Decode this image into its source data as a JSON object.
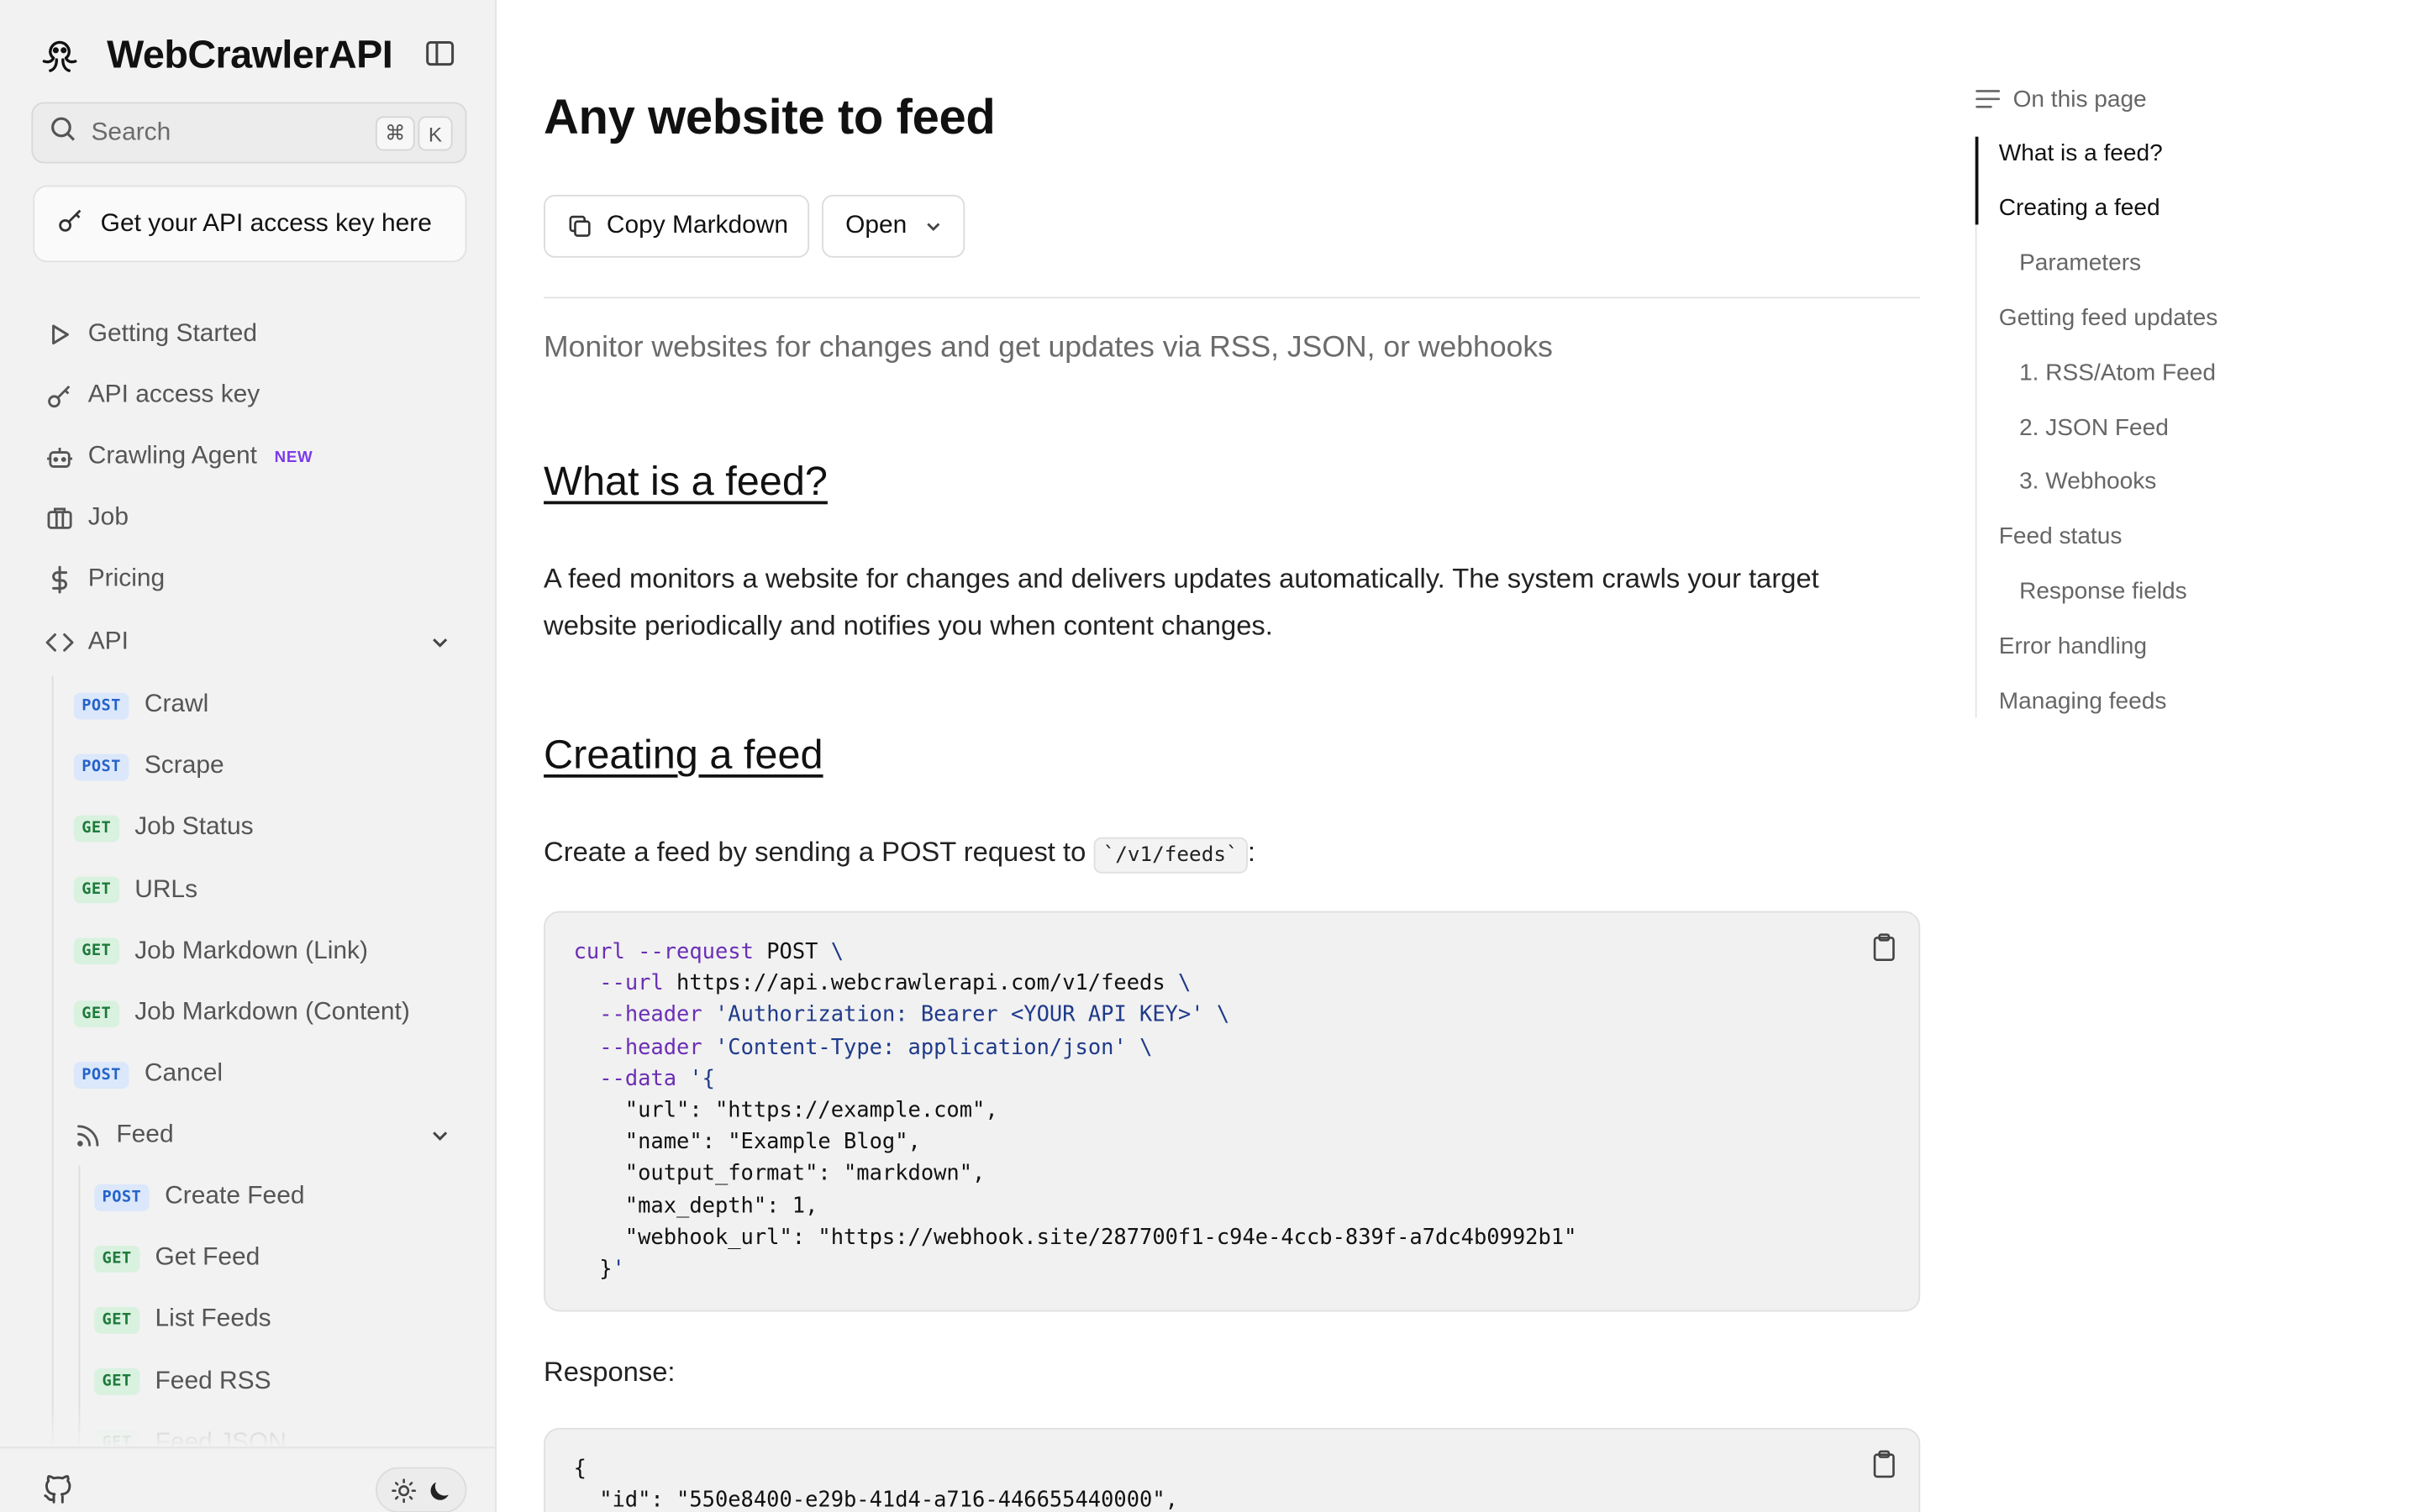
{
  "brand": {
    "name": "WebCrawlerAPI"
  },
  "search": {
    "label": "Search",
    "kbd_cmd": "⌘",
    "kbd_key": "K"
  },
  "api_key_cta": {
    "label": "Get your API access key here"
  },
  "nav": {
    "getting_started": "Getting Started",
    "api_access_key": "API access key",
    "crawling_agent": "Crawling Agent",
    "new_badge": "NEW",
    "job": "Job",
    "pricing": "Pricing",
    "api": "API"
  },
  "api_endpoints": [
    {
      "method": "POST",
      "label": "Crawl"
    },
    {
      "method": "POST",
      "label": "Scrape"
    },
    {
      "method": "GET",
      "label": "Job Status"
    },
    {
      "method": "GET",
      "label": "URLs"
    },
    {
      "method": "GET",
      "label": "Job Markdown (Link)"
    },
    {
      "method": "GET",
      "label": "Job Markdown (Content)"
    },
    {
      "method": "POST",
      "label": "Cancel"
    }
  ],
  "feed_group": {
    "label": "Feed"
  },
  "feed_endpoints": [
    {
      "method": "POST",
      "label": "Create Feed"
    },
    {
      "method": "GET",
      "label": "Get Feed"
    },
    {
      "method": "GET",
      "label": "List Feeds"
    },
    {
      "method": "GET",
      "label": "Feed RSS"
    },
    {
      "method": "GET",
      "label": "Feed JSON"
    }
  ],
  "page": {
    "title": "Any website to feed",
    "copy_markdown": "Copy Markdown",
    "open": "Open",
    "subtitle": "Monitor websites for changes and get updates via RSS, JSON, or webhooks",
    "section1_heading": "What is a feed?",
    "section1_text": "A feed monitors a website for changes and delivers updates automatically. The system crawls your target website periodically and notifies you when content changes.",
    "section2_heading": "Creating a feed",
    "section2_text_before": "Create a feed by sending a POST request to ",
    "section2_code": "`/v1/feeds`",
    "section2_text_after": ":",
    "response_label": "Response:"
  },
  "code_request": "curl --request POST \\\n  --url https://api.webcrawlerapi.com/v1/feeds \\\n  --header 'Authorization: Bearer <YOUR API KEY>' \\\n  --header 'Content-Type: application/json' \\\n  --data '{\n    \"url\": \"https://example.com\",\n    \"name\": \"Example Blog\",\n    \"output_format\": \"markdown\",\n    \"max_depth\": 1,\n    \"webhook_url\": \"https://webhook.site/287700f1-c94e-4ccb-839f-a7dc4b0992b1\"\n  }'",
  "code_response": "{\n  \"id\": \"550e8400-e29b-41d4-a716-446655440000\",\n  \"url\": \"https://example.com\",",
  "toc": {
    "heading": "On this page",
    "items": [
      {
        "label": "What is a feed?",
        "level": 1
      },
      {
        "label": "Creating a feed",
        "level": 1
      },
      {
        "label": "Parameters",
        "level": 2
      },
      {
        "label": "Getting feed updates",
        "level": 1
      },
      {
        "label": "1. RSS/Atom Feed",
        "level": 2
      },
      {
        "label": "2. JSON Feed",
        "level": 2
      },
      {
        "label": "3. Webhooks",
        "level": 2
      },
      {
        "label": "Feed status",
        "level": 1
      },
      {
        "label": "Response fields",
        "level": 2
      },
      {
        "label": "Error handling",
        "level": 1
      },
      {
        "label": "Managing feeds",
        "level": 1
      }
    ]
  },
  "colors": {
    "sidebar_bg": "#f2f2f2",
    "post_badge": "#2563c9",
    "get_badge": "#1d7a3a",
    "new_badge": "#7c3aed",
    "keyword": "#6b2fb5",
    "string": "#1f3a8a"
  }
}
